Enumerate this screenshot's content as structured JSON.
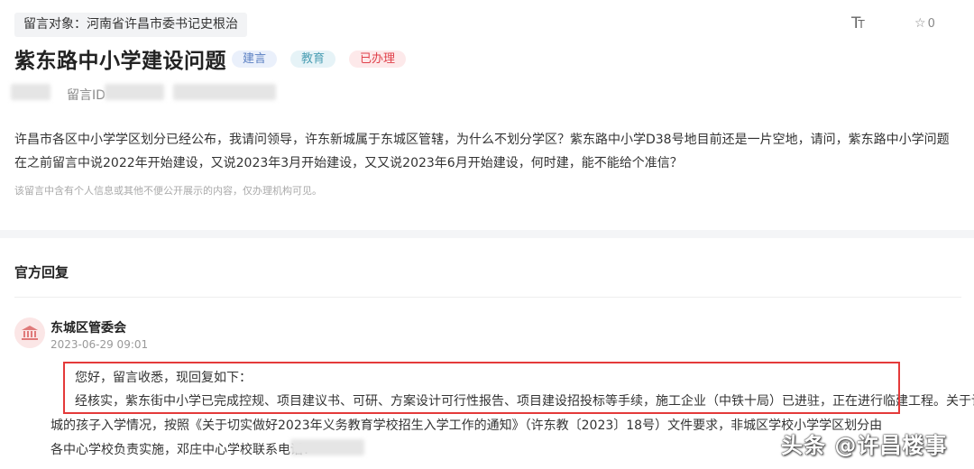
{
  "header": {
    "target_label": "留言对象：河南省许昌市委书记史根治",
    "font_size_icon": "font-size-icon",
    "favorite": {
      "icon": "star-outline-icon",
      "count": "0"
    }
  },
  "message": {
    "title": "紫东路中小学建设问题",
    "badges": {
      "type": "建言",
      "field": "教育",
      "status": "已办理"
    },
    "id_label": "留言ID",
    "body": "许昌市各区中小学学区划分已经公布，我请问领导，许东新城属于东城区管辖，为什么不划分学区？紫东路中小学D38号地目前还是一片空地，请问，紫东路中小学问题在之前留言中说2022年开始建设，又说2023年3月开始建设，又又说2023年6月开始建设，何时建，能不能给个准信？",
    "privacy_note": "该留言中含有个人信息或其他不便公开展示的内容，仅办理机构可见。"
  },
  "reply": {
    "section_title": "官方回复",
    "department": "东城区管委会",
    "time": "2023-06-29 09:01",
    "lines": [
      "您好，留言收悉，现回复如下：",
      "经核实，紫东街中小学已完成控规、项目建议书、可研、方案设计可行性报告、项目建设招投标等手续，施工企业（中铁十局）已进驻，正在进行临建工程。关于许东新",
      "城的孩子入学情况，按照《关于切实做好2023年义务教育学校招生入学工作的通知》（许东教〔2023〕18号）文件要求，非城区学校小学学区划分由",
      "各中心学校负责实施，邓庄中心学校联系电话："
    ]
  },
  "watermark": "头条 @许昌楼事",
  "colors": {
    "status_red": "#e0404a",
    "highlight_border": "#e43a3a",
    "accent_blue": "#5a7fc2"
  }
}
